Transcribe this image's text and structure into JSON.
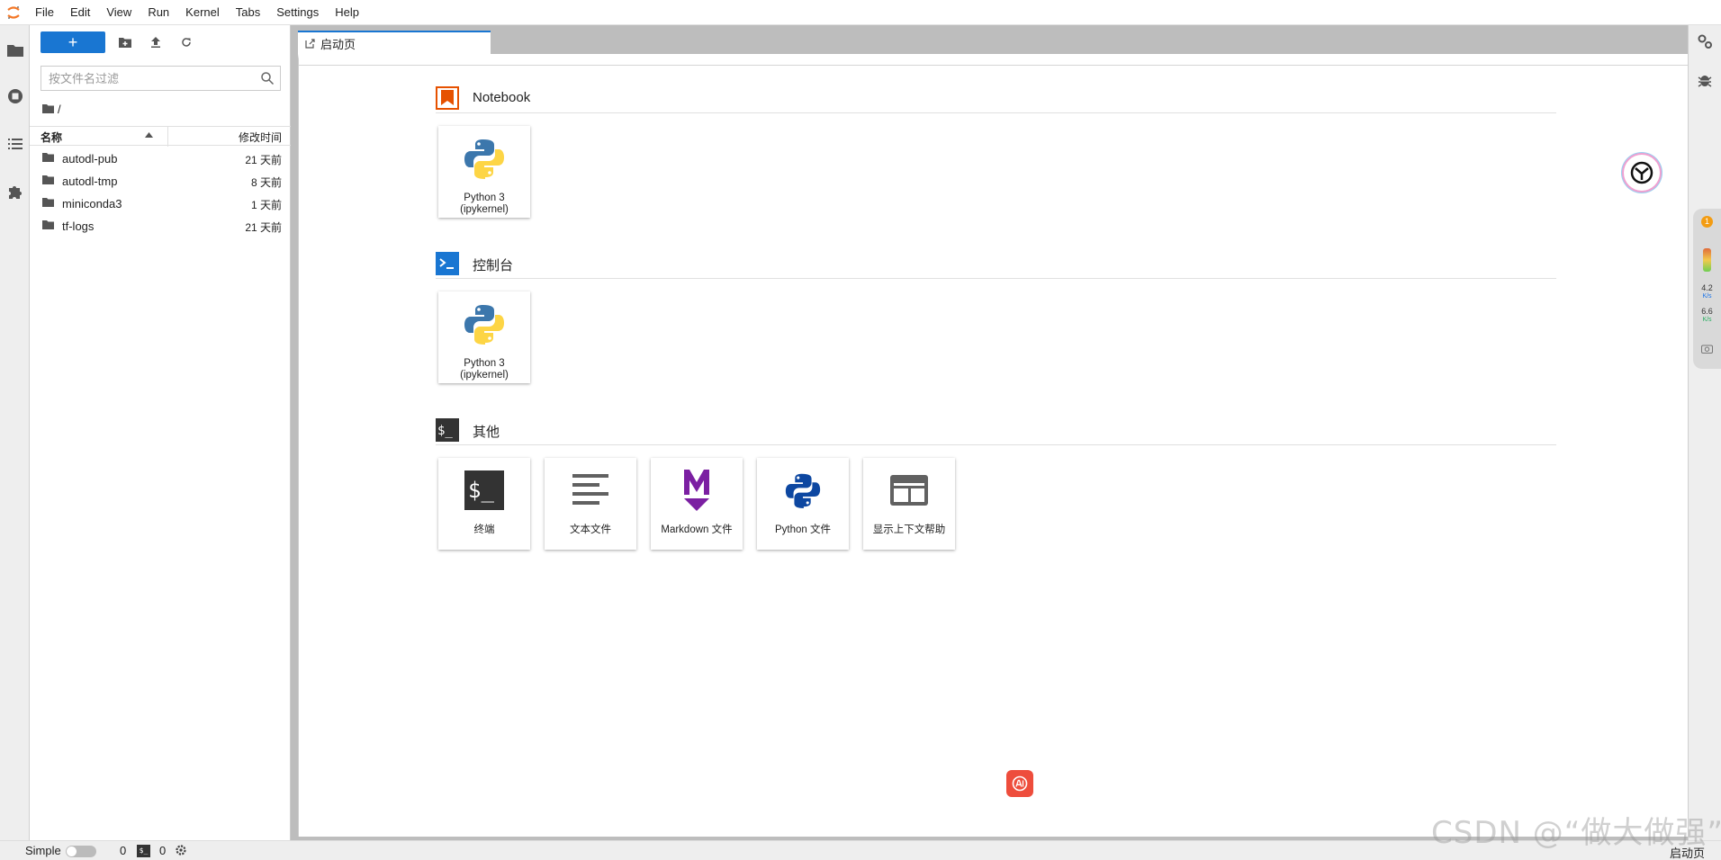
{
  "menubar": {
    "items": [
      "File",
      "Edit",
      "View",
      "Run",
      "Kernel",
      "Tabs",
      "Settings",
      "Help"
    ]
  },
  "filebrowser": {
    "new_button_label": "+",
    "search_placeholder": "按文件名过滤",
    "breadcrumb": "/",
    "columns": {
      "name": "名称",
      "modified": "修改时间"
    },
    "files": [
      {
        "name": "autodl-pub",
        "modified": "21 天前"
      },
      {
        "name": "autodl-tmp",
        "modified": "8 天前"
      },
      {
        "name": "miniconda3",
        "modified": "1 天前"
      },
      {
        "name": "tf-logs",
        "modified": "21 天前"
      }
    ]
  },
  "tabs": {
    "launcher": "启动页"
  },
  "launcher": {
    "sections": [
      {
        "title": "Notebook",
        "cards": [
          {
            "label": "Python 3 (ipykernel)"
          }
        ]
      },
      {
        "title": "控制台",
        "cards": [
          {
            "label": "Python 3 (ipykernel)"
          }
        ]
      },
      {
        "title": "其他",
        "cards": [
          {
            "label": "终端"
          },
          {
            "label": "文本文件"
          },
          {
            "label": "Markdown 文件"
          },
          {
            "label": "Python 文件"
          },
          {
            "label": "显示上下文帮助"
          }
        ]
      }
    ]
  },
  "perf_widget": {
    "badge": "1",
    "upload_value": "4.2",
    "upload_unit": "K/s",
    "download_value": "6.6",
    "download_unit": "K/s"
  },
  "statusbar": {
    "simple_label": "Simple",
    "kernels": "0",
    "terminal_glyph": "$_",
    "terminals": "0",
    "right_label": "启动页"
  },
  "watermark": "CSDN @“做大做强”",
  "colors": {
    "accent": "#1976d2",
    "notebook_icon": "#e65100",
    "console_icon": "#1976d2",
    "markdown_icon": "#7b1fa2",
    "python_file_icon": "#0d47a1"
  }
}
